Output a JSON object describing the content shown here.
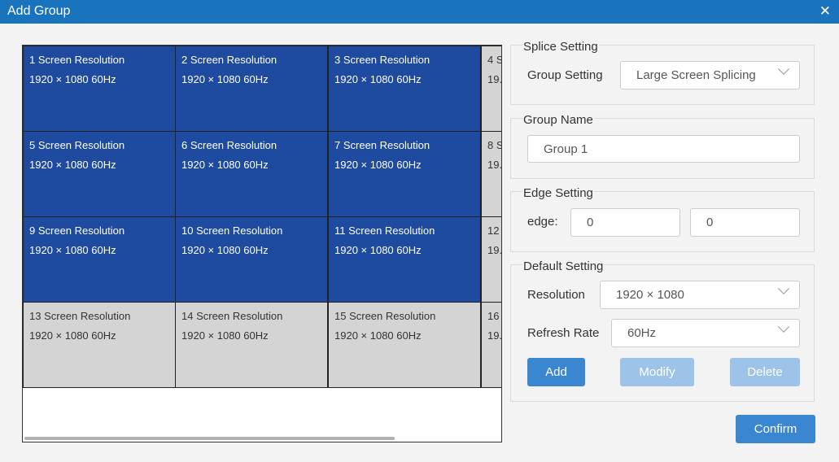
{
  "dialog": {
    "title": "Add Group"
  },
  "grid": {
    "cells": [
      {
        "label": "1 Screen Resolution",
        "resolution": "1920 × 1080 60Hz",
        "selected": true
      },
      {
        "label": "2 Screen Resolution",
        "resolution": "1920 × 1080 60Hz",
        "selected": true
      },
      {
        "label": "3 Screen Resolution",
        "resolution": "1920 × 1080 60Hz",
        "selected": true
      },
      {
        "label": "4 S",
        "resolution": "19.",
        "selected": false
      },
      {
        "label": "5 Screen Resolution",
        "resolution": "1920 × 1080 60Hz",
        "selected": true
      },
      {
        "label": "6 Screen Resolution",
        "resolution": "1920 × 1080 60Hz",
        "selected": true
      },
      {
        "label": "7 Screen Resolution",
        "resolution": "1920 × 1080 60Hz",
        "selected": true
      },
      {
        "label": "8 S",
        "resolution": "19.",
        "selected": false
      },
      {
        "label": "9 Screen Resolution",
        "resolution": "1920 × 1080 60Hz",
        "selected": true
      },
      {
        "label": "10 Screen Resolution",
        "resolution": "1920 × 1080 60Hz",
        "selected": true
      },
      {
        "label": "11 Screen Resolution",
        "resolution": "1920 × 1080 60Hz",
        "selected": true
      },
      {
        "label": "12",
        "resolution": "19.",
        "selected": false
      },
      {
        "label": "13 Screen Resolution",
        "resolution": "1920 × 1080 60Hz",
        "selected": false
      },
      {
        "label": "14 Screen Resolution",
        "resolution": "1920 × 1080 60Hz",
        "selected": false
      },
      {
        "label": "15 Screen Resolution",
        "resolution": "1920 × 1080 60Hz",
        "selected": false
      },
      {
        "label": "16",
        "resolution": "19.",
        "selected": false
      }
    ]
  },
  "splice_setting": {
    "legend": "Splice Setting",
    "group_setting_label": "Group Setting",
    "group_setting_value": "Large Screen Splicing"
  },
  "group_name": {
    "legend": "Group Name",
    "value": "Group 1"
  },
  "edge_setting": {
    "legend": "Edge Setting",
    "label": "edge:",
    "value1": "0",
    "value2": "0"
  },
  "default_setting": {
    "legend": "Default Setting",
    "resolution_label": "Resolution",
    "resolution_value": "1920 × 1080",
    "refresh_label": "Refresh Rate",
    "refresh_value": "60Hz",
    "add_label": "Add",
    "modify_label": "Modify",
    "delete_label": "Delete"
  },
  "confirm_label": "Confirm",
  "colors": {
    "titlebar": "#1a73bd",
    "selected_cell": "#1e4aa0",
    "unselected_cell": "#d4d4d4",
    "primary_button": "#3b86d0",
    "disabled_button": "#9ec3e8"
  }
}
